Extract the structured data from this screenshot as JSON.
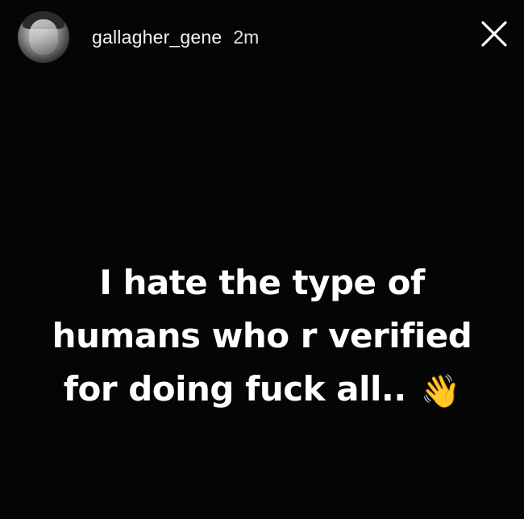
{
  "story": {
    "username": "gallagher_gene",
    "timestamp": "2m",
    "caption_lines": [
      "I hate the type of",
      "humans who r verified",
      "for doing fuck all.."
    ],
    "caption_emoji": "👋",
    "emoji_name": "waving-hand-icon"
  },
  "colors": {
    "background": "#050505",
    "text": "#ffffff"
  }
}
